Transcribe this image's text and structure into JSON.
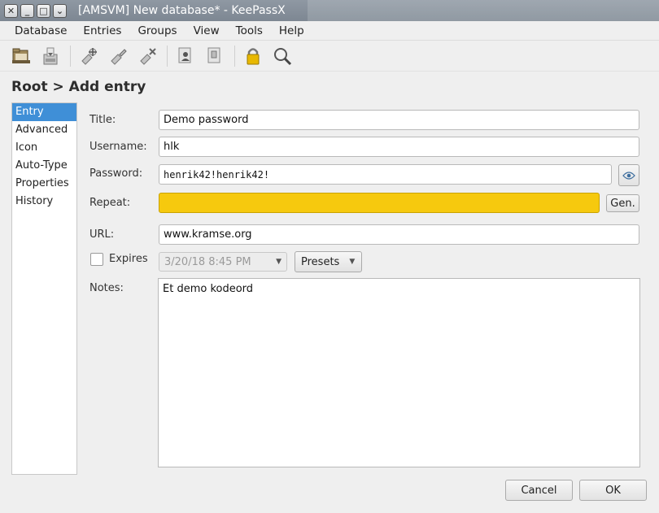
{
  "window": {
    "title": "[AMSVM] New database* - KeePassX",
    "controls": {
      "close": "✕",
      "minimize": "_",
      "maximize": "□",
      "menu": "⌄"
    }
  },
  "menubar": {
    "items": [
      "Database",
      "Entries",
      "Groups",
      "View",
      "Tools",
      "Help"
    ]
  },
  "toolbar": {
    "icons": [
      "open-database-icon",
      "save-database-icon",
      "add-entry-icon",
      "edit-entry-icon",
      "delete-entry-icon",
      "copy-username-icon",
      "copy-password-icon",
      "lock-database-icon",
      "search-icon"
    ]
  },
  "heading": "Root > Add entry",
  "sidebar": {
    "items": [
      "Entry",
      "Advanced",
      "Icon",
      "Auto-Type",
      "Properties",
      "History"
    ],
    "selected": "Entry"
  },
  "form": {
    "title_label": "Title:",
    "title_value": "Demo password",
    "username_label": "Username:",
    "username_value": "hlk",
    "password_label": "Password:",
    "password_value": "henrik42!henrik42!",
    "repeat_label": "Repeat:",
    "repeat_value": "",
    "gen_label": "Gen.",
    "url_label": "URL:",
    "url_value": "www.kramse.org",
    "expires_label": "Expires",
    "expires_checked": false,
    "expires_date": "3/20/18 8:45 PM",
    "presets_label": "Presets",
    "notes_label": "Notes:",
    "notes_value": "Et demo kodeord"
  },
  "buttons": {
    "cancel": "Cancel",
    "ok": "OK"
  },
  "colors": {
    "selection": "#3f8fd7",
    "repeat_warning": "#f6c90e",
    "lock_icon": "#e8b800"
  }
}
